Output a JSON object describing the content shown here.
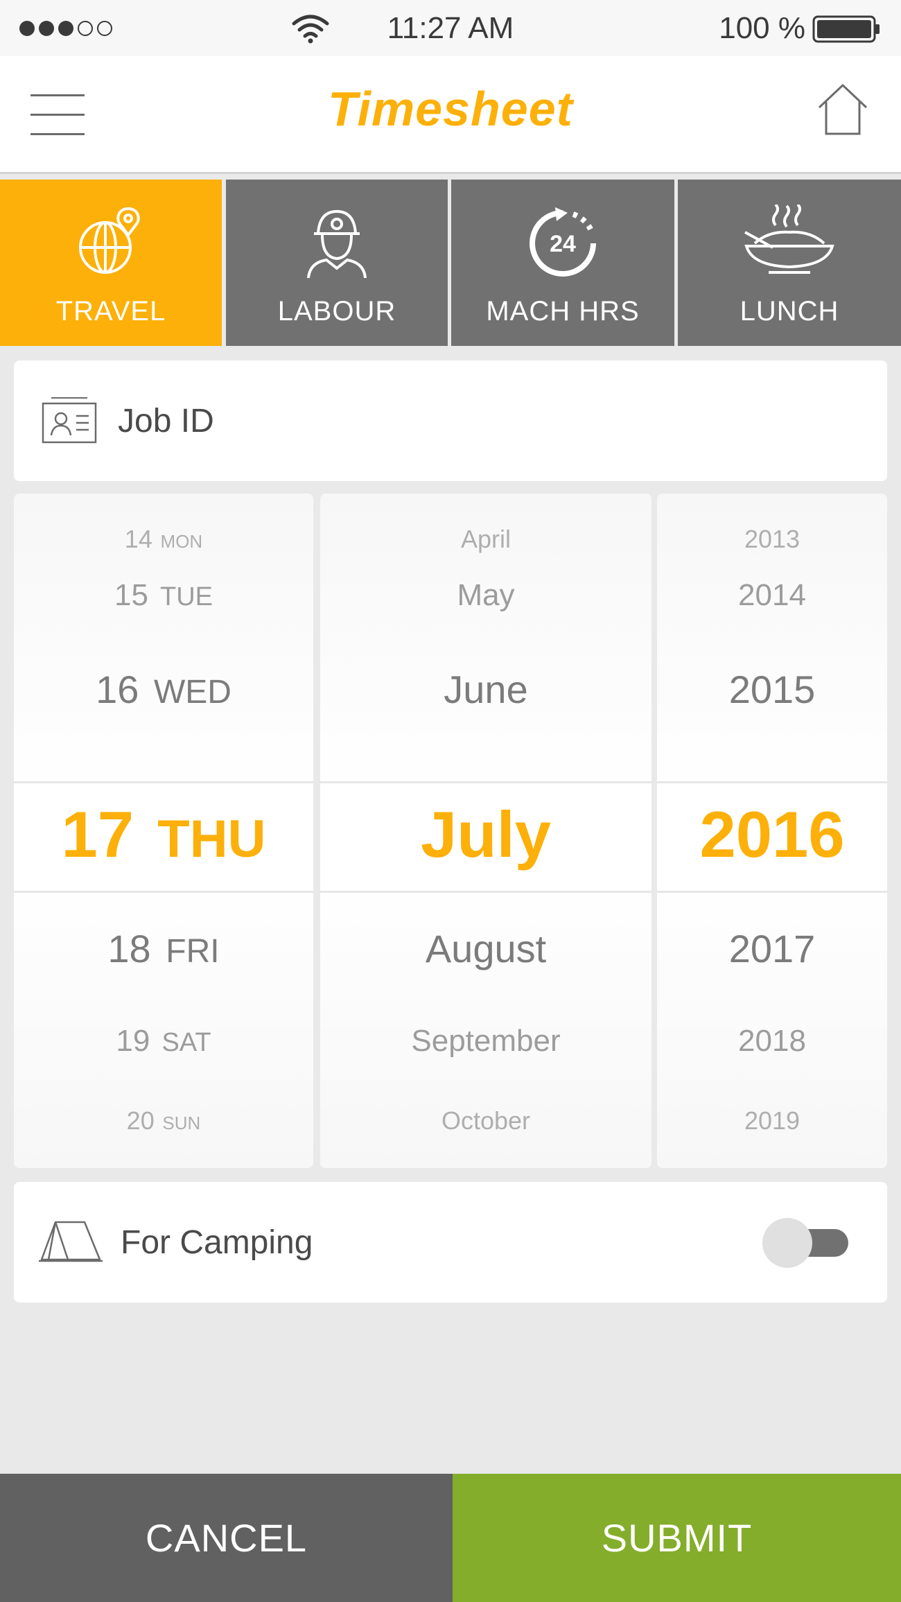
{
  "status_bar": {
    "signal_full": 3,
    "signal_empty": 2,
    "time": "11:27 AM",
    "battery": "100 %"
  },
  "header": {
    "title": "Timesheet",
    "menu_icon": "hamburger-icon",
    "home_icon": "home-icon"
  },
  "tabs": [
    {
      "label": "TRAVEL",
      "icon": "globe-pin-icon",
      "active": true
    },
    {
      "label": "LABOUR",
      "icon": "worker-icon",
      "active": false
    },
    {
      "label": "MACH HRS",
      "icon": "24-hours-icon",
      "active": false
    },
    {
      "label": "LUNCH",
      "icon": "food-bowl-icon",
      "active": false
    }
  ],
  "job": {
    "label": "Job ID",
    "icon": "id-card-icon"
  },
  "picker": {
    "days": [
      {
        "num": "14",
        "dow": "MON"
      },
      {
        "num": "15",
        "dow": "TUE"
      },
      {
        "num": "16",
        "dow": "WED"
      },
      {
        "num": "17",
        "dow": "THU"
      },
      {
        "num": "18",
        "dow": "FRI"
      },
      {
        "num": "19",
        "dow": "SAT"
      },
      {
        "num": "20",
        "dow": "SUN"
      }
    ],
    "months": [
      "April",
      "May",
      "June",
      "July",
      "August",
      "September",
      "October"
    ],
    "years": [
      "2013",
      "2014",
      "2015",
      "2016",
      "2017",
      "2018",
      "2019"
    ],
    "selected_index": 3
  },
  "camping": {
    "label": "For Camping",
    "icon": "tent-icon",
    "enabled": false
  },
  "footer": {
    "cancel_label": "CANCEL",
    "submit_label": "SUBMIT"
  },
  "colors": {
    "accent": "#fcb009",
    "tab_inactive": "#717171",
    "cancel": "#616161",
    "submit": "#84ad2c"
  }
}
